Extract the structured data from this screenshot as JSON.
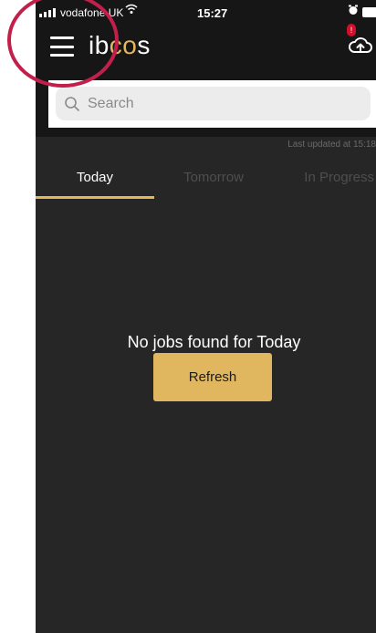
{
  "status_bar": {
    "carrier": "vodafone UK",
    "time": "15:27"
  },
  "header": {
    "logo_prefix": "ib",
    "logo_accent": "co",
    "logo_suffix": "s",
    "notification_badge": "!",
    "menu_icon": "hamburger-menu-icon",
    "cloud_icon": "cloud-upload-icon"
  },
  "search": {
    "placeholder": "Search",
    "value": ""
  },
  "last_updated": "Last updated at 15:18",
  "tabs": [
    {
      "label": "Today",
      "active": true
    },
    {
      "label": "Tomorrow",
      "active": false
    },
    {
      "label": "In Progress",
      "active": false
    }
  ],
  "empty_state": {
    "message": "No jobs found for Today",
    "refresh_label": "Refresh"
  },
  "colors": {
    "accent": "#e4b85a",
    "background": "#262626",
    "appbar": "#161616",
    "annotation": "#c2204a"
  }
}
